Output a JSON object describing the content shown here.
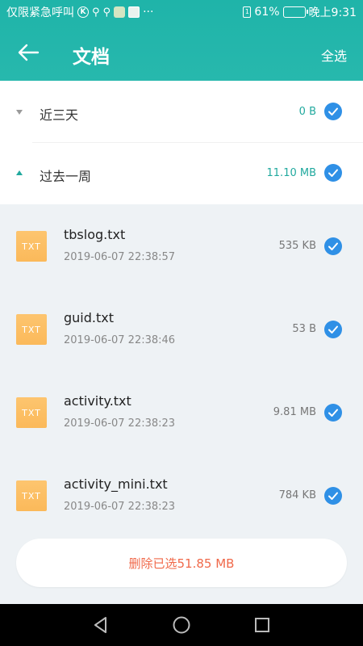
{
  "statusbar": {
    "carrier_text": "仅限紧急呼叫",
    "more_icon": "···",
    "battery_percent": "61%",
    "battery_level": 0.61,
    "time": "晚上9:31"
  },
  "header": {
    "title": "文档",
    "select_all": "全选"
  },
  "groups": [
    {
      "label": "近三天",
      "size": "0 B",
      "expanded": false,
      "checked": true
    },
    {
      "label": "过去一周",
      "size": "11.10 MB",
      "expanded": true,
      "checked": true
    }
  ],
  "files": [
    {
      "icon_label": "TXT",
      "name": "tbslog.txt",
      "date": "2019-06-07 22:38:57",
      "size": "535 KB",
      "checked": true
    },
    {
      "icon_label": "TXT",
      "name": "guid.txt",
      "date": "2019-06-07 22:38:46",
      "size": "53 B",
      "checked": true
    },
    {
      "icon_label": "TXT",
      "name": "activity.txt",
      "date": "2019-06-07 22:38:23",
      "size": "9.81 MB",
      "checked": true
    },
    {
      "icon_label": "TXT",
      "name": "activity_mini.txt",
      "date": "2019-06-07 22:38:23",
      "size": "784 KB",
      "checked": true
    }
  ],
  "footer": {
    "delete_label": "删除已选51.85 MB"
  },
  "colors": {
    "header": "#1fb4a9",
    "check": "#2f90e6",
    "accent_text": "#21a99e",
    "delete_text": "#f0694a",
    "file_icon": "#fbb95a"
  }
}
